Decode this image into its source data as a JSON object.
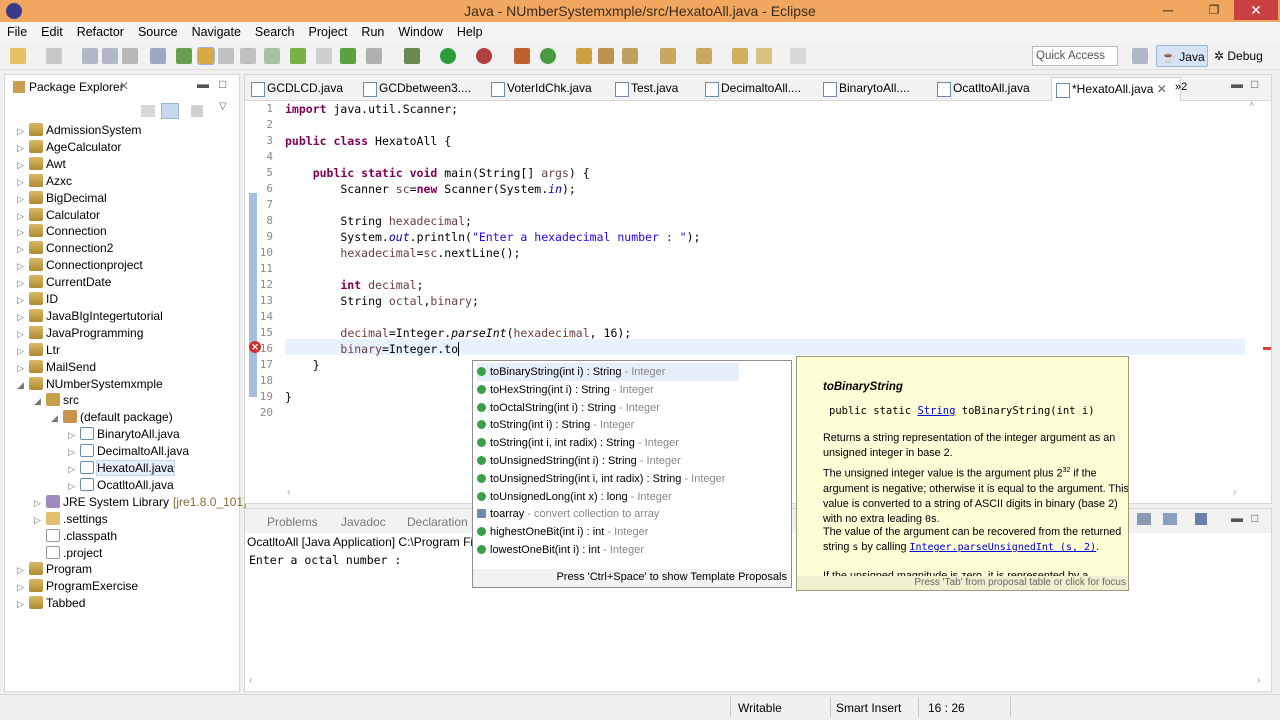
{
  "window": {
    "title": "Java - NUmberSystemxmple/src/HexatoAll.java - Eclipse",
    "minimize": "─",
    "maximize": "❐",
    "close": "✕"
  },
  "menu": [
    "File",
    "Edit",
    "Refactor",
    "Source",
    "Navigate",
    "Search",
    "Project",
    "Run",
    "Window",
    "Help"
  ],
  "toolbar": {
    "quick_access_placeholder": "Quick Access",
    "perspective_java": "Java",
    "perspective_debug": "Debug"
  },
  "package_explorer": {
    "title": "Package Explorer",
    "items": [
      {
        "label": "AdmissionSystem",
        "depth": 0,
        "expanded": false,
        "kind": "project"
      },
      {
        "label": "AgeCalculator",
        "depth": 0,
        "expanded": false,
        "kind": "project"
      },
      {
        "label": "Awt",
        "depth": 0,
        "expanded": false,
        "kind": "project"
      },
      {
        "label": "Azxc",
        "depth": 0,
        "expanded": false,
        "kind": "project"
      },
      {
        "label": "BigDecimal",
        "depth": 0,
        "expanded": false,
        "kind": "project"
      },
      {
        "label": "Calculator",
        "depth": 0,
        "expanded": false,
        "kind": "project"
      },
      {
        "label": "Connection",
        "depth": 0,
        "expanded": false,
        "kind": "project"
      },
      {
        "label": "Connection2",
        "depth": 0,
        "expanded": false,
        "kind": "project"
      },
      {
        "label": "Connectionproject",
        "depth": 0,
        "expanded": false,
        "kind": "project"
      },
      {
        "label": "CurrentDate",
        "depth": 0,
        "expanded": false,
        "kind": "project"
      },
      {
        "label": "ID",
        "depth": 0,
        "expanded": false,
        "kind": "project"
      },
      {
        "label": "JavaBIgIntegertutorial",
        "depth": 0,
        "expanded": false,
        "kind": "project"
      },
      {
        "label": "JavaProgramming",
        "depth": 0,
        "expanded": false,
        "kind": "project"
      },
      {
        "label": "Ltr",
        "depth": 0,
        "expanded": false,
        "kind": "project"
      },
      {
        "label": "MailSend",
        "depth": 0,
        "expanded": false,
        "kind": "project"
      },
      {
        "label": "NUmberSystemxmple",
        "depth": 0,
        "expanded": true,
        "kind": "project"
      },
      {
        "label": "src",
        "depth": 1,
        "expanded": true,
        "kind": "src"
      },
      {
        "label": "(default package)",
        "depth": 2,
        "expanded": true,
        "kind": "pkg"
      },
      {
        "label": "BinarytoAll.java",
        "depth": 3,
        "expanded": false,
        "kind": "java"
      },
      {
        "label": "DecimaltoAll.java",
        "depth": 3,
        "expanded": false,
        "kind": "java"
      },
      {
        "label": "HexatoAll.java",
        "depth": 3,
        "expanded": false,
        "kind": "java",
        "selected": true
      },
      {
        "label": "OcatltoAll.java",
        "depth": 3,
        "expanded": false,
        "kind": "java"
      },
      {
        "label": "JRE System Library",
        "suffix": "[jre1.8.0_101]",
        "depth": 1,
        "expanded": false,
        "kind": "lib"
      },
      {
        "label": ".settings",
        "depth": 1,
        "expanded": false,
        "kind": "folder"
      },
      {
        "label": ".classpath",
        "depth": 1,
        "expanded": null,
        "kind": "file"
      },
      {
        "label": ".project",
        "depth": 1,
        "expanded": null,
        "kind": "file"
      },
      {
        "label": "Program",
        "depth": 0,
        "expanded": false,
        "kind": "project"
      },
      {
        "label": "ProgramExercise",
        "depth": 0,
        "expanded": false,
        "kind": "project"
      },
      {
        "label": "Tabbed",
        "depth": 0,
        "expanded": false,
        "kind": "project"
      }
    ]
  },
  "editor_tabs": [
    {
      "label": "GCDLCD.java"
    },
    {
      "label": "GCDbetween3...."
    },
    {
      "label": "VoterIdChk.java"
    },
    {
      "label": "Test.java"
    },
    {
      "label": "DecimaltoAll...."
    },
    {
      "label": "BinarytoAll...."
    },
    {
      "label": "OcatltoAll.java"
    },
    {
      "label": "*HexatoAll.java",
      "active": true
    }
  ],
  "editor_tabs_overflow": "»2",
  "line_numbers": [
    "1",
    "2",
    "3",
    "4",
    "5",
    "6",
    "7",
    "8",
    "9",
    "10",
    "11",
    "12",
    "13",
    "14",
    "15",
    "16",
    "17",
    "18",
    "19",
    "20"
  ],
  "code": {
    "l1a": "import",
    "l1b": " java.util.Scanner;",
    "l3a": "public class",
    "l3b": " HexatoAll {",
    "l5a": "    public static void",
    "l5b": " main(String[] ",
    "l5c": "args",
    "l5d": ") {",
    "l6a": "        Scanner ",
    "l6b": "sc",
    "l6c": "=",
    "l6d": "new",
    "l6e": " Scanner(System.",
    "l6f": "in",
    "l6g": ");",
    "l8a": "        String ",
    "l8b": "hexadecimal",
    "l8c": ";",
    "l9a": "        System.",
    "l9b": "out",
    "l9c": ".println(",
    "l9d": "\"Enter a hexadecimal number : \"",
    "l9e": ");",
    "l10a": "        ",
    "l10b": "hexadecimal",
    "l10c": "=",
    "l10d": "sc",
    "l10e": ".nextLine();",
    "l12a": "        int",
    "l12b": " ",
    "l12c": "decimal",
    "l12d": ";",
    "l13a": "        String ",
    "l13b": "octal",
    "l13c": ",",
    "l13d": "binary",
    "l13e": ";",
    "l15a": "        ",
    "l15b": "decimal",
    "l15c": "=Integer.",
    "l15d": "parseInt",
    "l15e": "(",
    "l15f": "hexadecimal",
    "l15g": ", 16);",
    "l16a": "        ",
    "l16b": "binary",
    "l16c": "=Integer.to",
    "l17": "    }",
    "l19": "}"
  },
  "console": {
    "tabs": [
      "Problems",
      "Javadoc",
      "Declaration"
    ],
    "description": "OcatltoAll [Java Application] C:\\Program File",
    "output": "Enter a octal number :"
  },
  "content_assist": {
    "proposals": [
      {
        "name": "toBinaryString(int i) : String",
        "type": " - Integer",
        "selected": true
      },
      {
        "name": "toHexString(int i) : String",
        "type": " - Integer"
      },
      {
        "name": "toOctalString(int i) : String",
        "type": " - Integer"
      },
      {
        "name": "toString(int i) : String",
        "type": " - Integer"
      },
      {
        "name": "toString(int i, int radix) : String",
        "type": " - Integer"
      },
      {
        "name": "toUnsignedString(int i) : String",
        "type": " - Integer"
      },
      {
        "name": "toUnsignedString(int i, int radix) : String",
        "type": " - Integer"
      },
      {
        "name": "toUnsignedLong(int x) : long",
        "type": " - Integer"
      },
      {
        "name": "toarray",
        "type": " - convert collection to array",
        "template": true
      },
      {
        "name": "highestOneBit(int i) : int",
        "type": " - Integer"
      },
      {
        "name": "lowestOneBit(int i) : int",
        "type": " - Integer"
      }
    ],
    "hint": "Press 'Ctrl+Space' to show Template Proposals"
  },
  "javadoc": {
    "title": "toBinaryString",
    "sig_pre": "public static ",
    "sig_type": "String",
    "sig_post": " toBinaryString(int i)",
    "p1": "Returns a string representation of the integer argument as an unsigned integer in base 2.",
    "p2a": "The unsigned integer value is the argument plus 2",
    "p2sup": "32",
    "p2b": " if the argument is negative; otherwise it is equal to the argument. This value is converted to a string of ASCII digits in binary (base 2) with no extra leading ",
    "p2code": "0",
    "p2c": "s.",
    "p3a": "The value of the argument can be recovered from the returned string ",
    "p3s": "s",
    "p3b": " by calling ",
    "p3link": "Integer.parseUnsignedInt (s, 2)",
    "p3c": ".",
    "p4": "If the unsigned magnitude is zero, it is represented by a",
    "hint": "Press 'Tab' from proposal table or click for focus"
  },
  "status": {
    "writable": "Writable",
    "insert_mode": "Smart Insert",
    "position": "16 : 26"
  }
}
